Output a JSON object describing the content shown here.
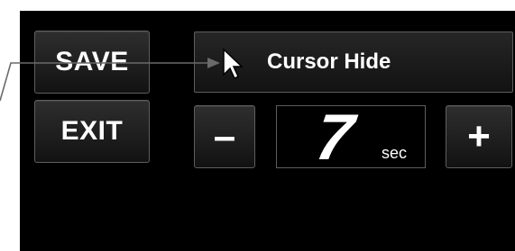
{
  "buttons": {
    "save_label": "SAVE",
    "exit_label": "EXIT",
    "minus_label": "–",
    "plus_label": "+"
  },
  "setting": {
    "title": "Cursor Hide",
    "value": "7",
    "unit": "sec"
  },
  "icons": {
    "title_icon": "arrow-cursor-icon",
    "annotation": "pointer-arrow-icon"
  },
  "colors": {
    "background": "#000000",
    "text": "#ffffff",
    "border": "#5e5e5e",
    "annotation": "#6a6a6a"
  }
}
